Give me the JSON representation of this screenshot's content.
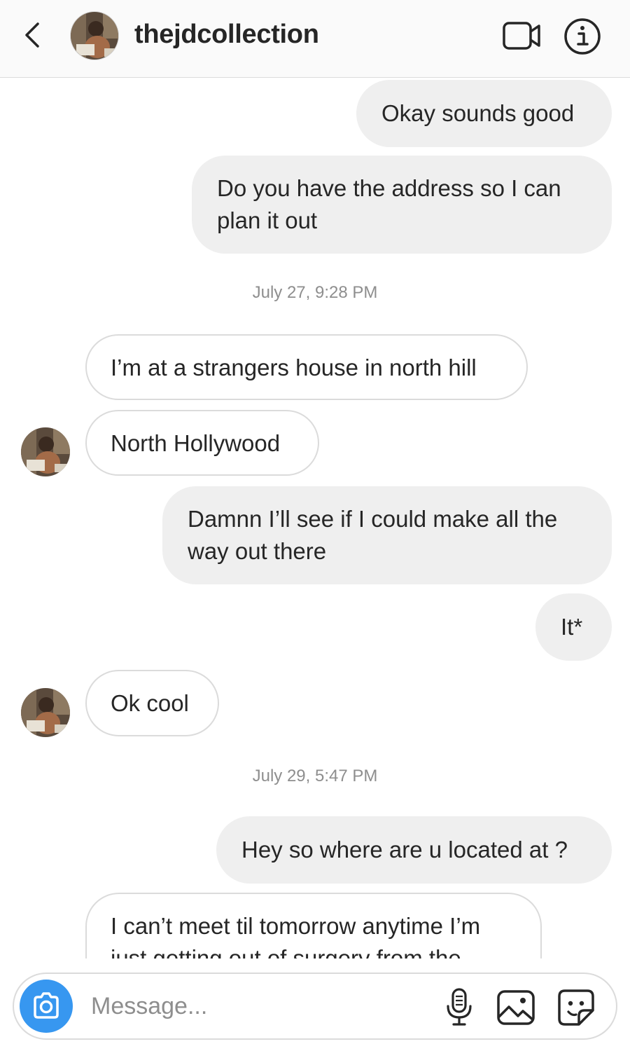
{
  "header": {
    "username": "thejdcollection"
  },
  "thread": {
    "messages": [
      {
        "side": "sent",
        "text": "Okay sounds good"
      },
      {
        "side": "sent",
        "text": "Do you have the address so I can plan it out"
      },
      {
        "type": "timestamp",
        "text": "July 27, 9:28 PM"
      },
      {
        "side": "received",
        "text": "I’m at a strangers house in north hill"
      },
      {
        "side": "received",
        "text": "North Hollywood"
      },
      {
        "side": "sent",
        "text": "Damnn I’ll see if I could make all the way out there"
      },
      {
        "side": "sent",
        "text": "It*"
      },
      {
        "side": "received",
        "text": "Ok cool"
      },
      {
        "type": "timestamp",
        "text": "July 29, 5:47 PM"
      },
      {
        "side": "sent",
        "text": "Hey so where are u located at ?"
      },
      {
        "side": "received",
        "text": "I can’t meet til tomorrow anytime I’m just getting out of surgery from the"
      }
    ]
  },
  "composer": {
    "placeholder": "Message..."
  },
  "colors": {
    "accent": "#3797f0",
    "sent_bubble": "#efefef",
    "received_border": "#dbdbdb",
    "timestamp_text": "#8e8e8e"
  },
  "icons": {
    "back": "chevron-left-icon",
    "video": "video-camera-icon",
    "info": "info-icon",
    "camera": "camera-icon",
    "mic": "microphone-icon",
    "gallery": "image-gallery-icon",
    "sticker": "sticker-icon"
  }
}
